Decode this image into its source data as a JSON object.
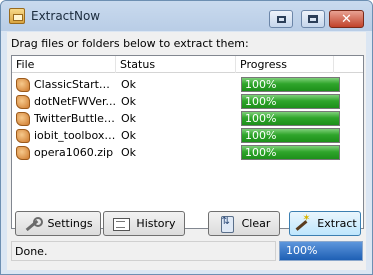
{
  "window": {
    "title": "ExtractNow",
    "app_icon": "extractnow-icon"
  },
  "instruction": "Drag files or folders below to extract them:",
  "columns": [
    "File",
    "Status",
    "Progress"
  ],
  "rows": [
    {
      "file": "ClassicStartM...",
      "status": "Ok",
      "progress_label": "100%",
      "progress": 1.0
    },
    {
      "file": "dotNetFWVer...",
      "status": "Ok",
      "progress_label": "100%",
      "progress": 1.0
    },
    {
      "file": "TwitterButtler...",
      "status": "Ok",
      "progress_label": "100%",
      "progress": 1.0
    },
    {
      "file": "iobit_toolbox....",
      "status": "Ok",
      "progress_label": "100%",
      "progress": 1.0
    },
    {
      "file": "opera1060.zip",
      "status": "Ok",
      "progress_label": "100%",
      "progress": 1.0
    }
  ],
  "buttons": {
    "settings": "Settings",
    "history": "History",
    "clear": "Clear",
    "extract": "Extract"
  },
  "status": {
    "text": "Done.",
    "progress_label": "100%",
    "progress": 1.0
  },
  "colors": {
    "progress_green": "#2fa52b",
    "status_blue": "#1e5fb4",
    "title_bar": "#c9daee",
    "close_red": "#c1422a"
  }
}
